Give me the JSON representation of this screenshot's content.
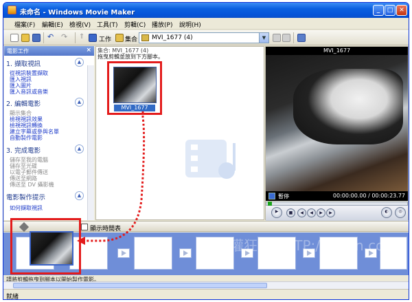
{
  "window": {
    "title": "未命名 - Windows Movie Maker"
  },
  "menu": [
    "檔案(F)",
    "編輯(E)",
    "檢視(V)",
    "工具(T)",
    "剪輯(C)",
    "播放(P)",
    "說明(H)"
  ],
  "toolbar": {
    "tasks_label": "工作",
    "collections_label": "集合",
    "collection_combo": "MVI_1677 (4)"
  },
  "taskpane": {
    "header": "電影工作",
    "sec1": {
      "title": "1. 擷取視訊",
      "links": [
        "從視訊裝置擷取",
        "匯入視訊",
        "匯入圖片",
        "匯入音訊或音樂"
      ]
    },
    "sec2": {
      "title": "2. 編輯電影",
      "gray": "顯示集合",
      "links": [
        "檢視視訊效果",
        "檢視視訊轉換",
        "建立字幕或參與名單",
        "自動製作電影"
      ]
    },
    "sec3": {
      "title": "3. 完成電影",
      "items": [
        "儲存至我的電腦",
        "儲存至光碟",
        "以電子郵件傳送",
        "傳送至網路",
        "傳送至 DV 攝影機"
      ]
    },
    "sec4": {
      "title": "電影製作提示",
      "link": "如何擷取視訊"
    }
  },
  "collection": {
    "title": "集合: MVI_1677 (4)",
    "subtitle": "拖曳剪輯並放到下方腳本。",
    "clip_label": "MVI_1677"
  },
  "preview": {
    "title": "MVI_1677",
    "status": "暫停",
    "time": "00:00:00.00 / 00:00:23.77"
  },
  "timeline": {
    "show_label": "顯示時間表",
    "instructions": "請將剪輯拖曳到腳本以開始製作電影。"
  },
  "statusbar": {
    "text": "就緒"
  },
  "watermark": "重灌狂人 HTTP://briian.com"
}
